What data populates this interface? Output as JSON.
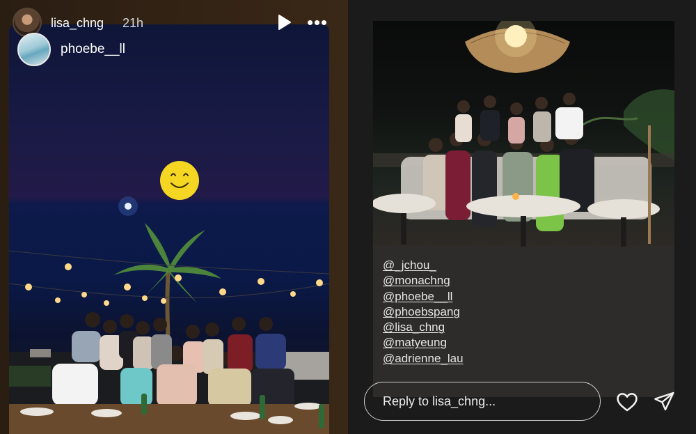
{
  "story_header": {
    "username": "lisa_chng",
    "time": "21h"
  },
  "mention_sticker": {
    "username": "phoebe__ll"
  },
  "mentions": [
    "@_jchou_",
    "@monachng",
    "@phoebe__ll",
    "@phoebspang",
    "@lisa_chng",
    "@matyeung",
    "@adrienne_lau"
  ],
  "reply": {
    "placeholder": "Reply to lisa_chng..."
  },
  "icons": {
    "play": "play-icon",
    "more": "more-icon",
    "heart": "heart-icon",
    "send": "send-icon",
    "smiley": "smiley-sticker-icon"
  },
  "colors": {
    "background": "#1b1b1b",
    "card": "#2d2c2b",
    "smiley": "#f5d623"
  }
}
